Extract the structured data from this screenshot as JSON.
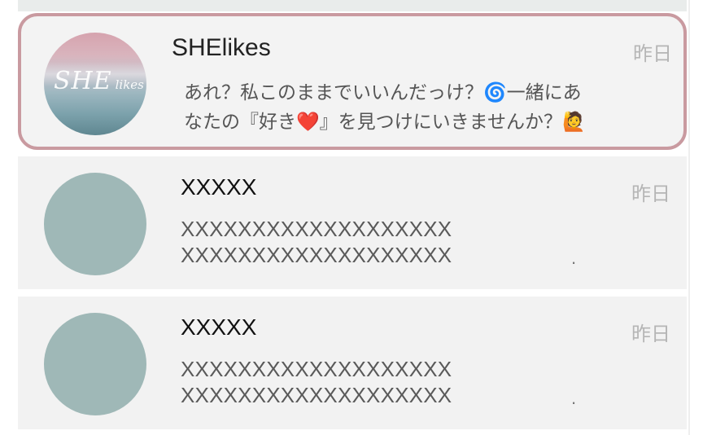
{
  "conversations": [
    {
      "name": "SHElikes",
      "time": "昨日",
      "message_line1": "あれ？私このままでいいんだっけ？🌀一緒にあ",
      "message_line2": "なたの『好き❤️』を見つけにいきませんか？🙋",
      "avatar": {
        "type": "brand-logo",
        "logo_text": "SHE likes",
        "color_top": "#d6a3ae",
        "color_bottom": "#5f8791"
      },
      "highlighted": true,
      "highlight_color": "#c99aa0"
    },
    {
      "name": "XXXXX",
      "time": "昨日",
      "message_line1": "XXXXXXXXXXXXXXXXXXX",
      "message_line2": "XXXXXXXXXXXXXXXXXXX",
      "trailing": ".",
      "avatar": {
        "type": "placeholder",
        "color": "#9fb8b7"
      }
    },
    {
      "name": "XXXXX",
      "time": "昨日",
      "message_line1": "XXXXXXXXXXXXXXXXXXX",
      "message_line2": "XXXXXXXXXXXXXXXXXXX",
      "trailing": ".",
      "avatar": {
        "type": "placeholder",
        "color": "#9fb8b7"
      }
    }
  ]
}
